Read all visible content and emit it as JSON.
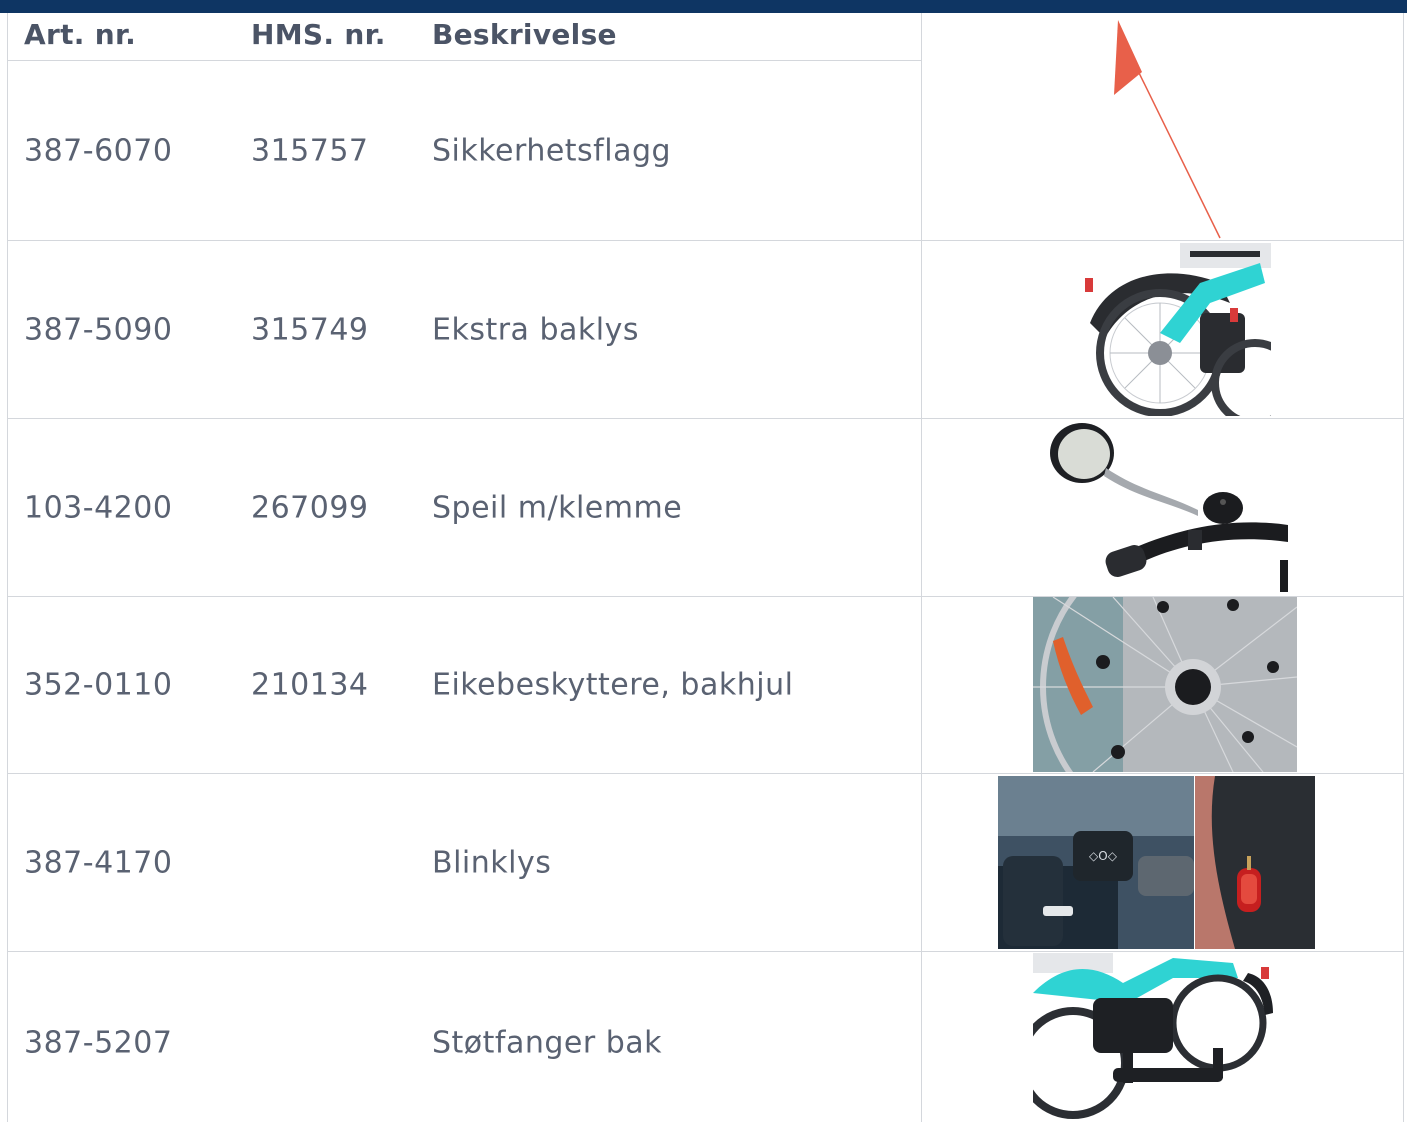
{
  "table": {
    "headers": [
      "Art. nr.",
      "HMS. nr.",
      "Beskrivelse"
    ],
    "rows": [
      {
        "art": "387-6070",
        "hms": "315757",
        "desc": "Sikkerhetsflagg",
        "image": "safety-flag"
      },
      {
        "art": "387-5090",
        "hms": "315749",
        "desc": "Ekstra baklys",
        "image": "extra-rear-light"
      },
      {
        "art": "103-4200",
        "hms": "267099",
        "desc": "Speil m/klemme",
        "image": "mirror-with-clamp"
      },
      {
        "art": "352-0110",
        "hms": "210134",
        "desc": "Eikebeskyttere, bakhjul",
        "image": "spoke-guards"
      },
      {
        "art": "387-4170",
        "hms": "",
        "desc": "Blinklys",
        "image": "turn-signals"
      },
      {
        "art": "387-5207",
        "hms": "",
        "desc": "Støtfanger bak",
        "image": "rear-bumper"
      }
    ]
  },
  "colors": {
    "header_bar": "#0e3563",
    "text": "#5a6272",
    "grid": "#d4d7dc",
    "bike_frame": "#2fd3d3",
    "flag": "#e8604a"
  }
}
